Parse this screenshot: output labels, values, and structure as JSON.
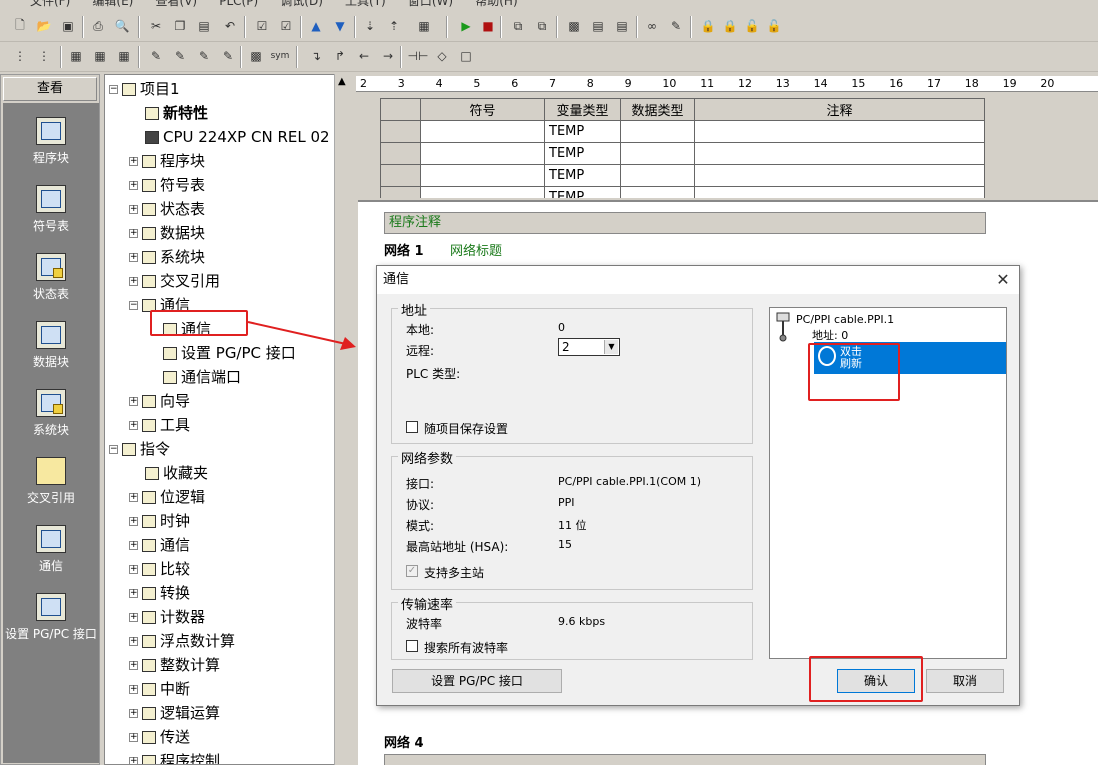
{
  "menubar": [
    "文件(F)",
    "编辑(E)",
    "查看(V)",
    "PLC(P)",
    "调试(D)",
    "工具(T)",
    "窗口(W)",
    "帮助(H)"
  ],
  "leftnav": {
    "header": "查看",
    "items": [
      "程序块",
      "符号表",
      "状态表",
      "数据块",
      "系统块",
      "交叉引用",
      "通信",
      "设置 PG/PC 接口"
    ]
  },
  "tree": {
    "project": "项目1",
    "new_features": "新特性",
    "cpu": "CPU 224XP CN REL 02",
    "nodes": [
      "程序块",
      "符号表",
      "状态表",
      "数据块",
      "系统块",
      "交叉引用",
      "通信"
    ],
    "comm_children": [
      "通信",
      "设置 PG/PC 接口",
      "通信端口"
    ],
    "after": [
      "向导",
      "工具"
    ],
    "instructions": "指令",
    "instr_children": [
      "收藏夹",
      "位逻辑",
      "时钟",
      "通信",
      "比较",
      "转换",
      "计数器",
      "浮点数计算",
      "整数计算",
      "中断",
      "逻辑运算",
      "传送",
      "程序控制"
    ]
  },
  "ruler": [
    "2",
    "3",
    "4",
    "5",
    "6",
    "7",
    "8",
    "9",
    "10",
    "11",
    "12",
    "13",
    "14",
    "15",
    "16",
    "17",
    "18",
    "19",
    "20"
  ],
  "vartable": {
    "headers": [
      "符号",
      "变量类型",
      "数据类型",
      "注释"
    ],
    "rows": [
      "TEMP",
      "TEMP",
      "TEMP",
      "TEMP"
    ]
  },
  "editor": {
    "program_comment": "程序注释",
    "network1": "网络 1",
    "network1_title": "网络标题",
    "network4": "网络 4"
  },
  "dialog": {
    "title": "通信",
    "address_group": "地址",
    "local_label": "本地:",
    "local_value": "0",
    "remote_label": "远程:",
    "remote_value": "2",
    "plc_type_label": "PLC 类型:",
    "save_with_project": "随项目保存设置",
    "network_group": "网络参数",
    "interface_label": "接口:",
    "interface_value": "PC/PPI cable.PPI.1(COM 1)",
    "protocol_label": "协议:",
    "protocol_value": "PPI",
    "mode_label": "模式:",
    "mode_value": "11 位",
    "hsa_label": "最高站地址 (HSA):",
    "hsa_value": "15",
    "multi_master": "支持多主站",
    "rate_group": "传输速率",
    "baud_label": "波特率",
    "baud_value": "9.6 kbps",
    "search_all_baud": "搜索所有波特率",
    "setup_button": "设置 PG/PC 接口",
    "ok_button": "确认",
    "cancel_button": "取消",
    "device": "PC/PPI cable.PPI.1",
    "device_address": "地址: 0",
    "refresh_line1": "双击",
    "refresh_line2": "刷新"
  },
  "colors": {
    "annotation_red": "#e02020",
    "selection_blue": "#0078d7",
    "comment_green": "#1b7a1b"
  }
}
